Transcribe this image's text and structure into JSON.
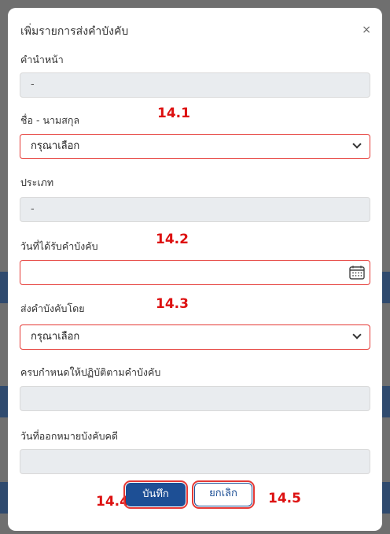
{
  "modal": {
    "title": "เพิ่มรายการส่งคำบังคับ",
    "close_glyph": "×"
  },
  "fields": {
    "prefix": {
      "label": "คำนำหน้า",
      "value": "-"
    },
    "fullname": {
      "label": "ชื่อ - นามสกุล",
      "value": "กรุณาเลือก"
    },
    "type": {
      "label": "ประเภท",
      "value": "-"
    },
    "received_date": {
      "label": "วันที่ได้รับคำบังคับ",
      "value": ""
    },
    "delivery_method": {
      "label": "ส่งคำบังคับโดย",
      "value": "กรุณาเลือก"
    },
    "due_date": {
      "label": "ครบกำหนดให้ปฏิบัติตามคำบังคับ",
      "value": ""
    },
    "warrant_date": {
      "label": "วันที่ออกหมายบังคับคดี",
      "value": ""
    }
  },
  "annotations": {
    "a1": "14.1",
    "a2": "14.2",
    "a3": "14.3",
    "a4": "14.4",
    "a5": "14.5"
  },
  "buttons": {
    "save_label": "บันทึก",
    "cancel_label": "ยกเลิก"
  },
  "icons": {
    "close": "close-icon",
    "dropdown": "chevron-down-icon",
    "calendar": "calendar-icon"
  },
  "colors": {
    "primary": "#1d4f95",
    "annotation": "#dd1111",
    "field_disabled": "#e9ecef"
  }
}
